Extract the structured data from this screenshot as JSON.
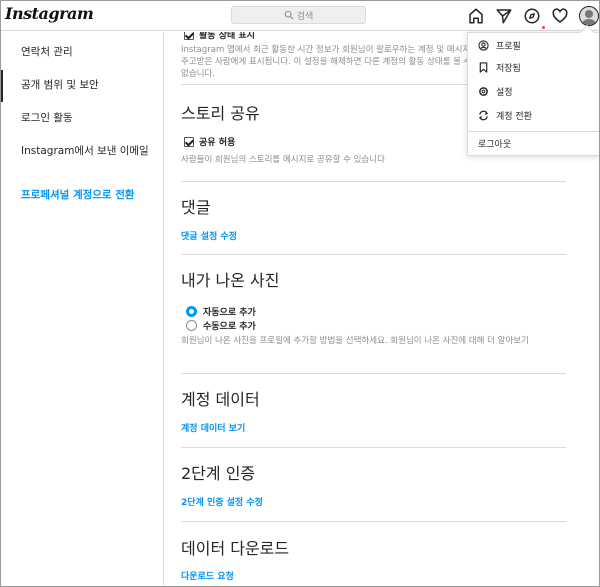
{
  "app": {
    "logo": "Instagram"
  },
  "search": {
    "placeholder": "검색"
  },
  "sidebar": {
    "items": [
      {
        "label": "연락처 관리"
      },
      {
        "label": "공개 범위 및 보안"
      },
      {
        "label": "로그인 활동"
      },
      {
        "label": "Instagram에서 보낸 이메일"
      },
      {
        "label": "프로페셔널 계정으로 전환"
      }
    ]
  },
  "main": {
    "activity": {
      "checkbox_label": "활동 상태 표시",
      "description": "Instagram 앱에서 최근 활동한 시간 정보가 회원님이 팔로우하는 계정 및 메시지를 주고받은 사람에게 표시됩니다. 이 설정을 해제하면 다른 계정의 활동 상태를 볼 수 없습니다."
    },
    "story": {
      "title": "스토리 공유",
      "checkbox_label": "공유 허용",
      "description": "사람들이 회원님의 스토리를 메시지로 공유할 수 있습니다"
    },
    "comments": {
      "title": "댓글",
      "link": "댓글 설정 수정"
    },
    "photos": {
      "title": "내가 나온 사진",
      "option_auto": "자동으로 추가",
      "option_manual": "수동으로 추가",
      "description": "회원님이 나온 사진을 프로필에 추가할 방법을 선택하세요. 회원님이 나온 사진에 대해 더 알아보기"
    },
    "account_data": {
      "title": "계정 데이터",
      "link": "계정 데이터 보기"
    },
    "two_factor": {
      "title": "2단계 인증",
      "link": "2단계 인증 설정 수정"
    },
    "download": {
      "title": "데이터 다운로드",
      "link": "다운로드 요청"
    }
  },
  "dropdown": {
    "profile": "프로필",
    "saved": "저장됨",
    "settings": "설정",
    "switch": "계정 전환",
    "logout": "로그아웃"
  },
  "colors": {
    "link": "#0095f6",
    "text": "#262626",
    "muted": "#8e8e8e",
    "border": "#dbdbdb"
  }
}
